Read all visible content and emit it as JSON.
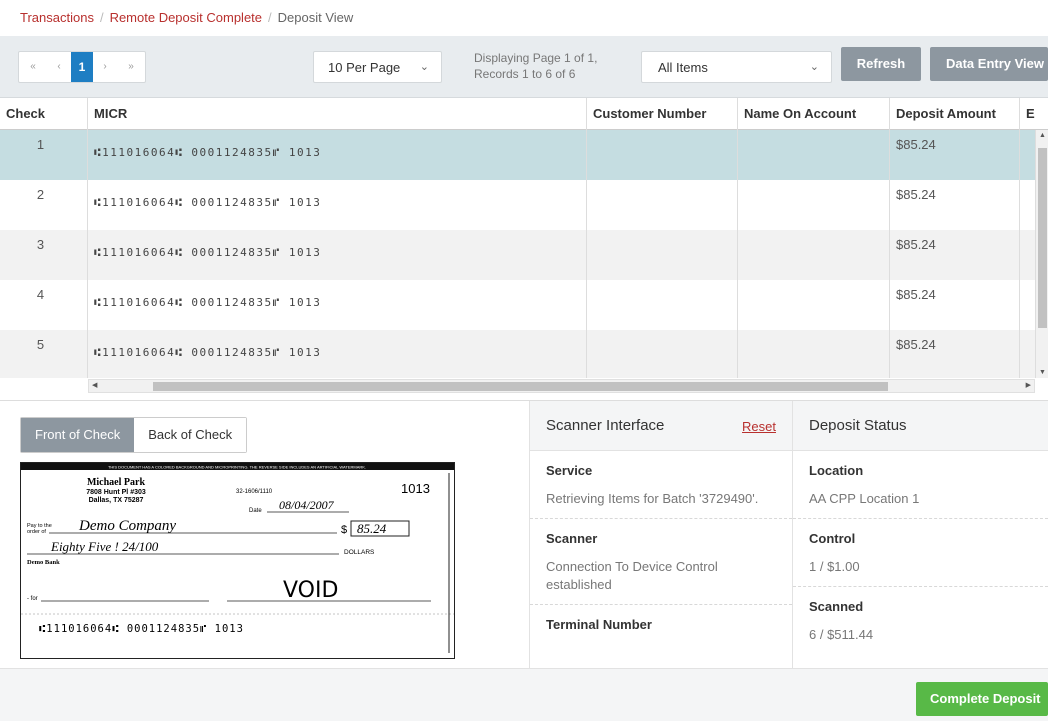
{
  "breadcrumb": {
    "items": [
      "Transactions",
      "Remote Deposit Complete"
    ],
    "current": "Deposit View"
  },
  "toolbar": {
    "pager": {
      "first": "«",
      "prev": "‹",
      "current": "1",
      "next": "›",
      "last": "»"
    },
    "per_page": "10 Per Page",
    "page_info_line1": "Displaying Page 1 of 1,",
    "page_info_line2": "Records 1 to 6 of 6",
    "filter": "All Items",
    "refresh_label": "Refresh",
    "data_entry_label": "Data Entry View"
  },
  "table": {
    "columns": [
      "Check",
      "MICR",
      "Customer Number",
      "Name On Account",
      "Deposit Amount",
      "E"
    ],
    "rows": [
      {
        "check": "1",
        "micr": "⑆111016064⑆ 0001124835⑈ 1013",
        "customer": "",
        "name": "",
        "amount": "$85.24"
      },
      {
        "check": "2",
        "micr": "⑆111016064⑆ 0001124835⑈ 1013",
        "customer": "",
        "name": "",
        "amount": "$85.24"
      },
      {
        "check": "3",
        "micr": "⑆111016064⑆ 0001124835⑈ 1013",
        "customer": "",
        "name": "",
        "amount": "$85.24"
      },
      {
        "check": "4",
        "micr": "⑆111016064⑆ 0001124835⑈ 1013",
        "customer": "",
        "name": "",
        "amount": "$85.24"
      },
      {
        "check": "5",
        "micr": "⑆111016064⑆ 0001124835⑈ 1013",
        "customer": "",
        "name": "",
        "amount": "$85.24"
      }
    ]
  },
  "check_tabs": {
    "front": "Front of Check",
    "back": "Back of Check"
  },
  "check_image": {
    "banner": "THIS DOCUMENT HAS A COLORED BACKGROUND AND MICROPRINTING. THE REVERSE SIDE INCLUDES AN ARTIFICIAL WATERMARK.",
    "name": "Michael Park",
    "address1": "7808 Hunt Pl #303",
    "address2": "Dallas, TX 75287",
    "routing_fraction": "32-1606/1110",
    "check_number": "1013",
    "date_label": "Date",
    "date_value": "08/04/2007",
    "pay_to_label1": "Pay to the",
    "pay_to_label2": "order of",
    "payee": "Demo Company",
    "amount_symbol": "$",
    "amount": "85.24",
    "written_amount": "Eighty Five ! 24/100",
    "dollars_label": "DOLLARS",
    "bank": "Demo Bank",
    "for_label": "- for",
    "signature": "VOID",
    "micr": "⑆111016064⑆ 0001124835⑈ 1013"
  },
  "scanner": {
    "title": "Scanner Interface",
    "reset_label": "Reset",
    "fields": [
      {
        "label": "Service",
        "value": "Retrieving Items for Batch '3729490'."
      },
      {
        "label": "Scanner",
        "value": "Connection To Device Control established"
      },
      {
        "label": "Terminal Number",
        "value": ""
      }
    ]
  },
  "status": {
    "title": "Deposit Status",
    "fields": [
      {
        "label": "Location",
        "value": "AA CPP Location 1"
      },
      {
        "label": "Control",
        "value": "1 / $1.00"
      },
      {
        "label": "Scanned",
        "value": "6 / $511.44"
      }
    ]
  },
  "footer": {
    "complete_label": "Complete Deposit"
  },
  "colors": {
    "accent_blue": "#1e7ec3",
    "link_red": "#b8302e",
    "button_grey": "#8d97a0",
    "success_green": "#58b947",
    "row_selected": "#c5dde1"
  }
}
